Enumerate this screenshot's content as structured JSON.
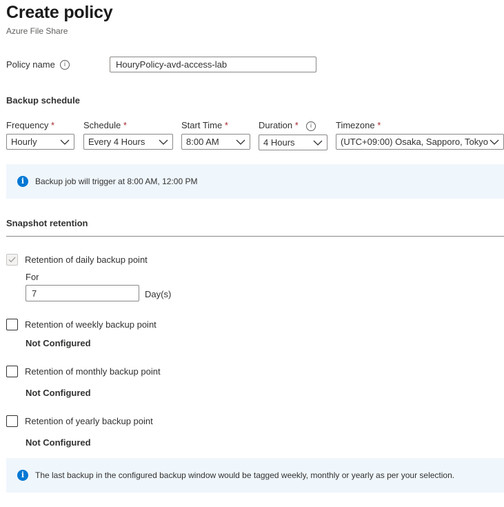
{
  "header": {
    "title": "Create policy",
    "subtitle": "Azure File Share"
  },
  "policy_name": {
    "label": "Policy name",
    "value": "HouryPolicy-avd-access-lab",
    "info_icon": "info-icon"
  },
  "backup_schedule": {
    "heading": "Backup schedule",
    "frequency": {
      "label": "Frequency",
      "value": "Hourly"
    },
    "schedule": {
      "label": "Schedule",
      "value": "Every 4 Hours"
    },
    "start_time": {
      "label": "Start Time",
      "value": "8:00 AM"
    },
    "duration": {
      "label": "Duration",
      "value": "4 Hours"
    },
    "timezone": {
      "label": "Timezone",
      "value": "(UTC+09:00) Osaka, Sapporo, Tokyo"
    },
    "required_mark": "*",
    "banner": "Backup job will trigger at 8:00 AM, 12:00 PM"
  },
  "snapshot_retention": {
    "heading": "Snapshot retention",
    "daily": {
      "label": "Retention of daily backup point",
      "for_label": "For",
      "value": "7",
      "unit": "Day(s)",
      "checked": true,
      "disabled": true
    },
    "weekly": {
      "label": "Retention of weekly backup point",
      "status": "Not Configured",
      "checked": false
    },
    "monthly": {
      "label": "Retention of monthly backup point",
      "status": "Not Configured",
      "checked": false
    },
    "yearly": {
      "label": "Retention of yearly backup point",
      "status": "Not Configured",
      "checked": false
    },
    "banner": "The last backup in the configured backup window would be tagged weekly, monthly or yearly as per your selection."
  },
  "colors": {
    "accent": "#0078d4",
    "banner_bg": "#eff6fc",
    "required": "#a4262c"
  }
}
